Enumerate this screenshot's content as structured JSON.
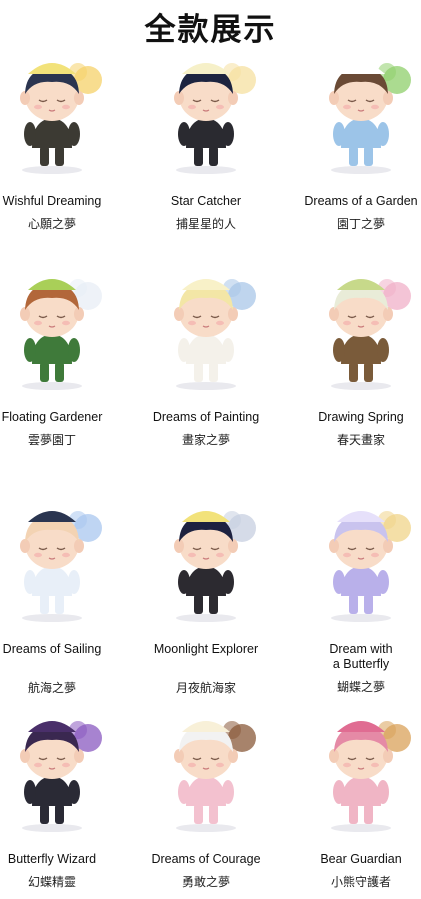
{
  "title": "全款展示",
  "figures": [
    {
      "en": "Wishful Dreaming",
      "zh": "心願之夢",
      "icon": "wishful-dreaming-figure-icon",
      "hair": "#2b3550",
      "hat": "#f2e27a",
      "outfit": "#3c3a33",
      "accent": "#f5d26a"
    },
    {
      "en": "Star Catcher",
      "zh": "捕星星的人",
      "icon": "star-catcher-figure-icon",
      "hair": "#1d2440",
      "hat": "#f6f0c8",
      "outfit": "#2a2a30",
      "accent": "#f5e0a0"
    },
    {
      "en": "Dreams of a Garden",
      "zh": "園丁之夢",
      "icon": "dreams-of-a-garden-figure-icon",
      "hair": "#6a4a35",
      "hat": "#ffffff",
      "outfit": "#9cc4e8",
      "accent": "#8fcf6b"
    },
    {
      "en": "Floating Gardener",
      "zh": "雲夢園丁",
      "icon": "floating-gardener-figure-icon",
      "hair": "#b2673a",
      "hat": "#a9cf58",
      "outfit": "#3f7a3a",
      "accent": "#e8eef5"
    },
    {
      "en": "Dreams of Painting",
      "zh": "畫家之夢",
      "icon": "dreams-of-painting-figure-icon",
      "hair": "#f3e6a6",
      "hat": "#f8f1c8",
      "outfit": "#f4f1ea",
      "accent": "#a9c7e8"
    },
    {
      "en": "Drawing Spring",
      "zh": "春天畫家",
      "icon": "drawing-spring-figure-icon",
      "hair": "#e9ecd8",
      "hat": "#c7d98a",
      "outfit": "#7a5b3a",
      "accent": "#f0b0c8"
    },
    {
      "en": "Dreams of Sailing",
      "zh": "航海之夢",
      "icon": "dreams-of-sailing-figure-icon",
      "hair": "#f3d3b3",
      "hat": "#2a3550",
      "outfit": "#e8eff8",
      "accent": "#a9c7ef"
    },
    {
      "en": "Moonlight Explorer",
      "zh": "月夜航海家",
      "icon": "moonlight-explorer-figure-icon",
      "hair": "#1d2240",
      "hat": "#f2e27a",
      "outfit": "#2c2a30",
      "accent": "#c7cfe0"
    },
    {
      "en": "Dream with\na Butterfly",
      "zh": "蝴蝶之夢",
      "icon": "dream-with-a-butterfly-figure-icon",
      "hair": "#c9c3ee",
      "hat": "#e6e0fa",
      "outfit": "#b9b0ea",
      "accent": "#f0d48a"
    },
    {
      "en": "Butterfly Wizard",
      "zh": "幻蝶精靈",
      "icon": "butterfly-wizard-figure-icon",
      "hair": "#3a2850",
      "hat": "#4a2f6a",
      "outfit": "#2a2a35",
      "accent": "#8a5ac0"
    },
    {
      "en": "Dreams of Courage",
      "zh": "勇敢之夢",
      "icon": "dreams-of-courage-figure-icon",
      "hair": "#f2f2f2",
      "hat": "#f8f0d8",
      "outfit": "#f3c1cf",
      "accent": "#8a5a3a"
    },
    {
      "en": "Bear Guardian",
      "zh": "小熊守護者",
      "icon": "bear-guardian-figure-icon",
      "hair": "#e58aa6",
      "hat": "#e06c92",
      "outfit": "#f0b5c5",
      "accent": "#d9a25a"
    }
  ]
}
